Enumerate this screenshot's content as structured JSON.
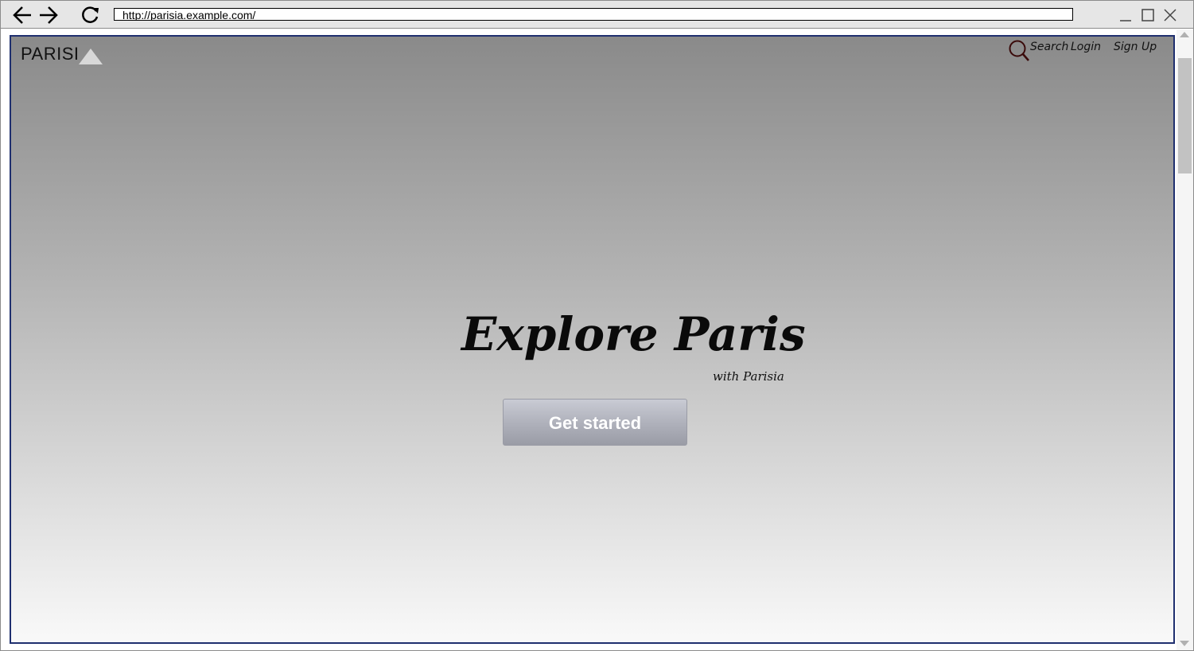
{
  "browser": {
    "url": "http://parisia.example.com/",
    "icons": {
      "back": "arrow-left-icon",
      "forward": "arrow-right-icon",
      "reload": "reload-icon",
      "minimize": "minimize-icon",
      "maximize": "maximize-icon",
      "close": "close-icon"
    }
  },
  "site": {
    "logo_text": "PARISI",
    "nav": {
      "search_label": "Search",
      "login_label": "Login",
      "signup_label": "Sign Up"
    },
    "hero": {
      "title": "Explore Paris",
      "subtitle": "with Parisia",
      "cta_label": "Get started"
    }
  },
  "colors": {
    "viewport_border": "#1f2f6f",
    "search_icon": "#3a0a0a",
    "gradient_top": "#8a8a8a",
    "gradient_bottom": "#f9f9f9"
  }
}
